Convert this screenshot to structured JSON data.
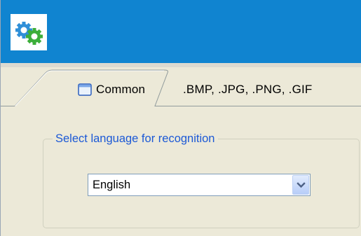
{
  "header": {
    "logo_icon": "gears-icon",
    "background_color": "#1084d0"
  },
  "tabs": [
    {
      "label": "Common",
      "icon": "window-icon",
      "active": true
    },
    {
      "label": ".BMP, .JPG, .PNG, .GIF",
      "active": false
    }
  ],
  "language_group": {
    "legend": "Select language for recognition",
    "legend_color": "#1c59d6",
    "dropdown": {
      "selected": "English",
      "arrow_icon": "chevron-down-icon"
    }
  }
}
